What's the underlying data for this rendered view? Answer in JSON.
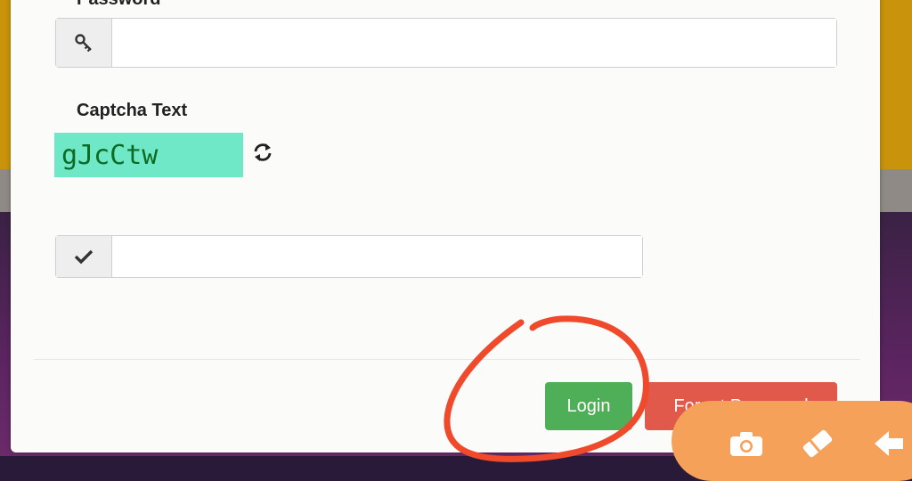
{
  "form": {
    "password_label": "Password",
    "password_value": "",
    "captcha_label": "Captcha Text",
    "captcha_text": "gJcCtw",
    "captcha_input_value": ""
  },
  "buttons": {
    "login": "Login",
    "forgot_password": "Forgot Password"
  },
  "icons": {
    "password_addon": "key-icon",
    "captcha_addon": "check-icon",
    "refresh": "refresh-icon",
    "toolbar": [
      "camera-icon",
      "eraser-icon",
      "undo-arrow-icon"
    ]
  },
  "colors": {
    "captcha_bg": "#6fe8c8",
    "captcha_text": "#0d6b22",
    "login_button": "#4fae58",
    "forgot_button": "#e0594a",
    "annotation": "#ef4a2c",
    "toolbar": "#f5a15a"
  }
}
